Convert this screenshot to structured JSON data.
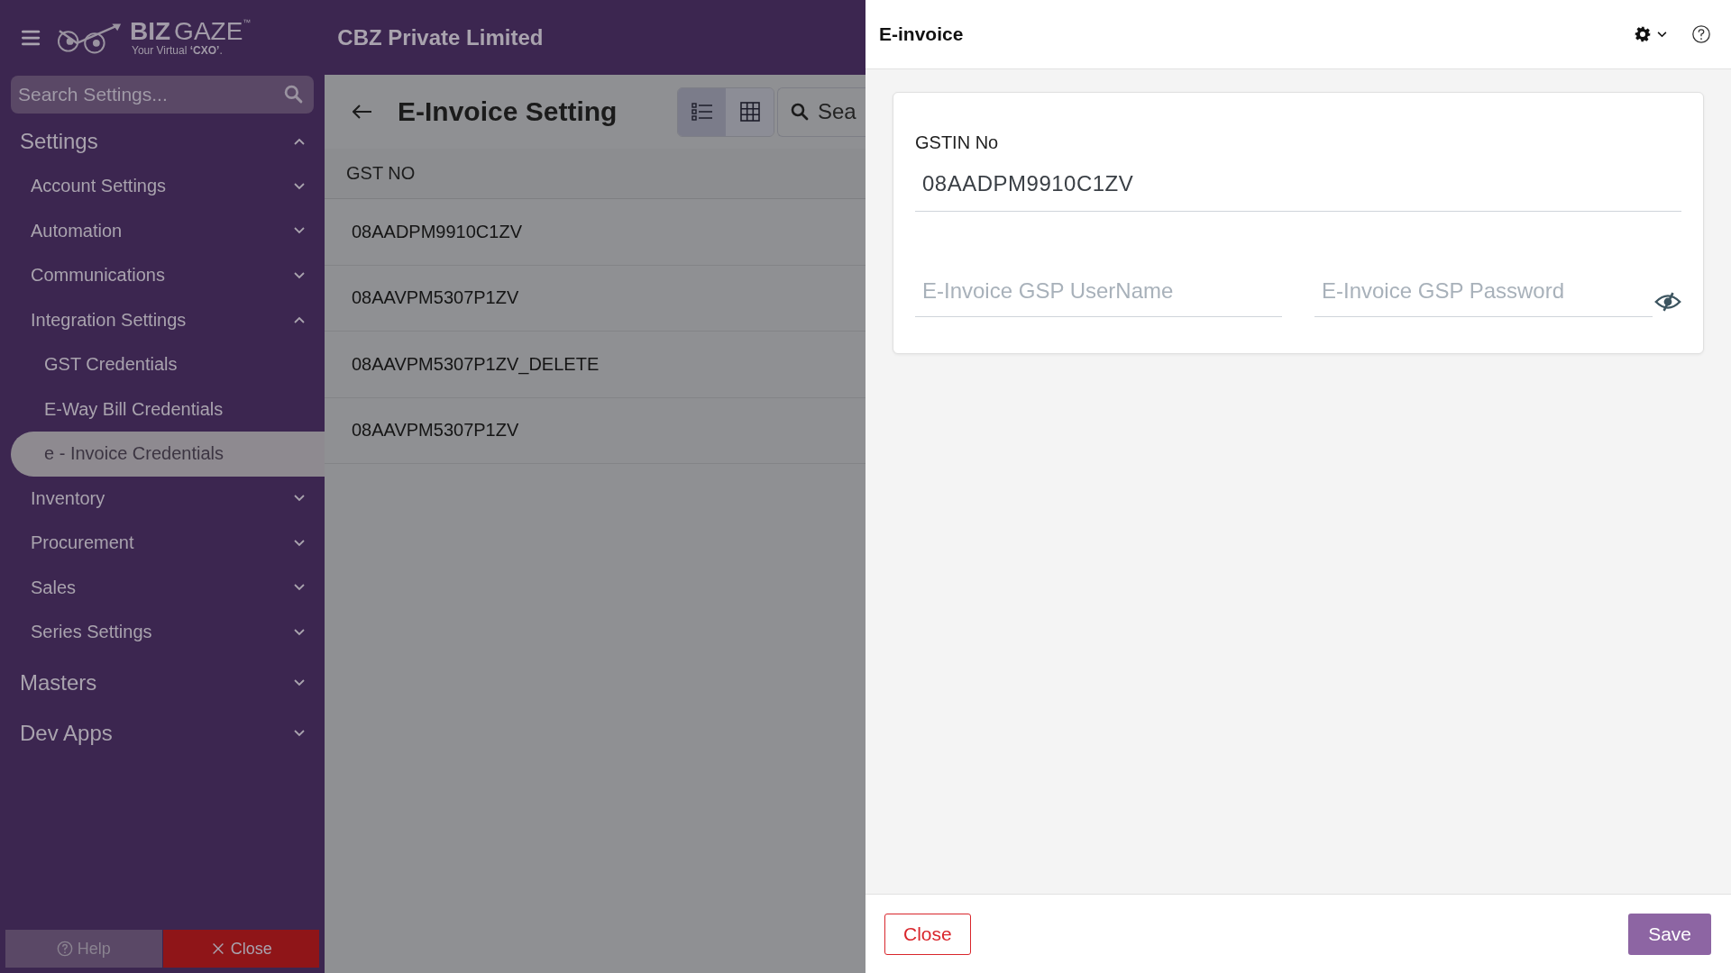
{
  "header": {
    "logo": {
      "bold": "BIZ",
      "light": "GAZE",
      "mark": "™",
      "tagline": "Your Virtual **‘CXO’**."
    },
    "company": "CBZ Private Limited"
  },
  "sidebar": {
    "search": {
      "placeholder": "Search Settings..."
    },
    "sections": [
      {
        "label": "Settings",
        "expanded": true,
        "children": [
          {
            "label": "Account Settings",
            "expanded": false
          },
          {
            "label": "Automation",
            "expanded": false
          },
          {
            "label": "Communications",
            "expanded": false
          },
          {
            "label": "Integration Settings",
            "expanded": true,
            "children": [
              {
                "label": "GST Credentials",
                "selected": false
              },
              {
                "label": "E-Way Bill Credentials",
                "selected": false
              },
              {
                "label": "e - Invoice Credentials",
                "selected": true
              }
            ]
          },
          {
            "label": "Inventory",
            "expanded": false
          },
          {
            "label": "Procurement",
            "expanded": false
          },
          {
            "label": "Sales",
            "expanded": false
          },
          {
            "label": "Series Settings",
            "expanded": false
          }
        ]
      },
      {
        "label": "Masters",
        "expanded": false
      },
      {
        "label": "Dev Apps",
        "expanded": false
      }
    ],
    "buttons": [
      {
        "kind": "help",
        "label": "Help"
      },
      {
        "kind": "close",
        "label": "Close"
      }
    ]
  },
  "page": {
    "title": "E-Invoice Setting",
    "views": [
      {
        "kind": "list",
        "selected": true
      },
      {
        "kind": "grid",
        "selected": false
      }
    ],
    "search": {
      "placeholder": "Sea"
    },
    "table": {
      "columns": [
        "GST NO"
      ],
      "rows": [
        [
          "08AADPM9910C1ZV"
        ],
        [
          "08AAVPM5307P1ZV"
        ],
        [
          "08AAVPM5307P1ZV_DELETE"
        ],
        [
          "08AAVPM5307P1ZV"
        ]
      ]
    }
  },
  "drawer": {
    "title": "E-invoice",
    "fields": [
      {
        "label": "GSTIN No",
        "value": "08AADPM9910C1ZV"
      }
    ],
    "credentials": [
      {
        "kind": "text",
        "placeholder": "E-Invoice GSP UserName"
      },
      {
        "kind": "password",
        "placeholder": "E-Invoice GSP Password"
      }
    ],
    "buttons": [
      {
        "kind": "secondary",
        "label": "Close"
      },
      {
        "kind": "primary",
        "label": "Save"
      }
    ]
  }
}
